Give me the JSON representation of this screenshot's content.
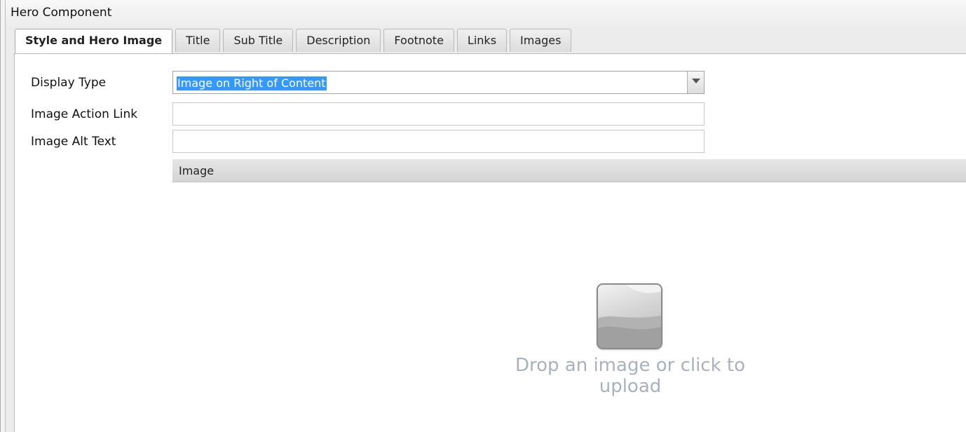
{
  "window": {
    "title": "Hero Component"
  },
  "tabs": [
    {
      "label": "Style and Hero Image",
      "active": true
    },
    {
      "label": "Title",
      "active": false
    },
    {
      "label": "Sub Title",
      "active": false
    },
    {
      "label": "Description",
      "active": false
    },
    {
      "label": "Footnote",
      "active": false
    },
    {
      "label": "Links",
      "active": false
    },
    {
      "label": "Images",
      "active": false
    }
  ],
  "form": {
    "display_type": {
      "label": "Display Type",
      "value": "Image on Right of Content"
    },
    "image_action_link": {
      "label": "Image Action Link",
      "value": ""
    },
    "image_alt_text": {
      "label": "Image Alt Text",
      "value": ""
    }
  },
  "image_section": {
    "header": "Image",
    "drop_text": "Drop an image or click to upload",
    "icon": "image-placeholder-icon"
  },
  "colors": {
    "selection": "#3399ff",
    "drop_text": "#a9b2bc"
  }
}
